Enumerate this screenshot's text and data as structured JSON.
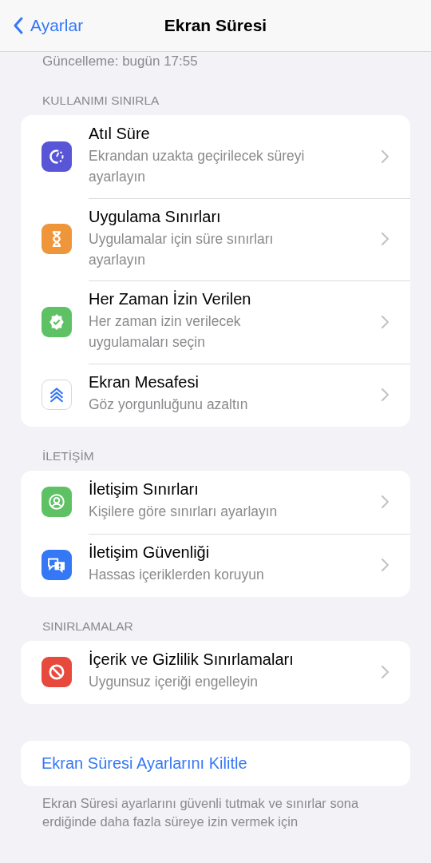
{
  "nav": {
    "back": "Ayarlar",
    "title": "Ekran Süresi"
  },
  "updated": "Güncelleme: bugün 17:55",
  "sections": [
    {
      "header": "KULLANIMI SINIRLA",
      "items": [
        {
          "title": "Atıl Süre",
          "subtitle": "Ekrandan uzakta geçirilecek süreyi ayarlayın",
          "color": "#5856d6"
        },
        {
          "title": "Uygulama Sınırları",
          "subtitle": "Uygulamalar için süre sınırları ayarlayın",
          "color": "#f0963a"
        },
        {
          "title": "Her Zaman İzin Verilen",
          "subtitle": "Her zaman izin verilecek uygulamaları seçin",
          "color": "#5ec265"
        },
        {
          "title": "Ekran Mesafesi",
          "subtitle": "Göz yorgunluğunu azaltın",
          "color": "#ffffff"
        }
      ]
    },
    {
      "header": "İLETİŞİM",
      "items": [
        {
          "title": "İletişim Sınırları",
          "subtitle": "Kişilere göre sınırları ayarlayın",
          "color": "#5ec265"
        },
        {
          "title": "İletişim Güvenliği",
          "subtitle": "Hassas içeriklerden koruyun",
          "color": "#3478f6"
        }
      ]
    },
    {
      "header": "SINIRLAMALAR",
      "items": [
        {
          "title": "İçerik ve Gizlilik Sınırlamaları",
          "subtitle": "Uygunsuz içeriği engelleyin",
          "color": "#e8493d"
        }
      ]
    }
  ],
  "lock_button": "Ekran Süresi Ayarlarını Kilitle",
  "footer": "Ekran Süresi ayarlarını güvenli tutmak ve sınırlar sona erdiğinde daha fazla süreye izin vermek için"
}
